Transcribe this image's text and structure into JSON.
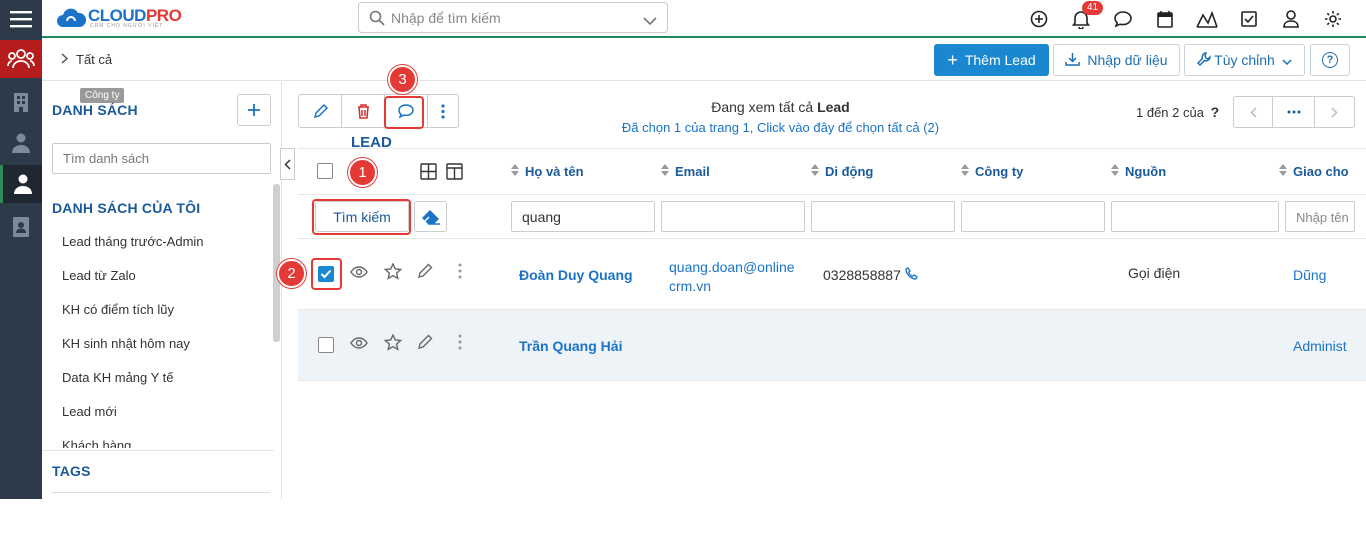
{
  "rail": {
    "items": [
      "menu-icon",
      "users-group-icon",
      "building-icon",
      "contacts-icon",
      "person-icon",
      "document-person-icon"
    ],
    "tooltip": "Công ty"
  },
  "topbar": {
    "logo_text_prefix": "CLOUD",
    "logo_text_suffix": "PRO",
    "logo_tagline": "CRM CHO NGƯỜI VIỆT",
    "search_placeholder": "Nhập để tìm kiếm",
    "notification_count": "41",
    "icons": [
      "plus-circle-icon",
      "bell-icon",
      "chat-icon",
      "calendar-icon",
      "chart-icon",
      "checkbox-icon",
      "user-icon",
      "gear-icon"
    ]
  },
  "breadcrumb": {
    "module": "LEAD",
    "view": "Tất cả"
  },
  "header_buttons": {
    "add": "Thêm Lead",
    "import": "Nhập dữ liệu",
    "customize": "Tùy chỉnh",
    "help": "?"
  },
  "sidebar": {
    "section_title": "DANH SÁCH",
    "filter_placeholder": "Tìm danh sách",
    "my_lists_title": "DANH SÁCH CỦA TÔI",
    "items": [
      "Lead tháng trước-Admin",
      "Lead từ Zalo",
      "KH có điểm tích lũy",
      "KH sinh nhật hôm nay",
      "Data KH mảng Y tế",
      "Lead mới",
      "Khách hàng"
    ],
    "tags_title": "TAGS"
  },
  "toolbar": {
    "viewing_prefix": "Đang xem tất cả",
    "viewing_module": "Lead",
    "selected_text": "Đã chọn 1 của trang 1, Click vào đây để chọn tất cả (2)",
    "pager_text": "1 đến 2 của",
    "pager_help": "?"
  },
  "table": {
    "columns": [
      "Họ và tên",
      "Email",
      "Di động",
      "Công ty",
      "Nguồn",
      "Giao cho"
    ],
    "search_button": "Tìm kiếm",
    "filters": {
      "name": "quang",
      "email": "",
      "mobile": "",
      "company": "",
      "source": "",
      "assigned_placeholder": "Nhập tên"
    },
    "rows": [
      {
        "checked": true,
        "name": "Đoàn Duy Quang",
        "email_line1": "quang.doan@online",
        "email_line2": "crm.vn",
        "mobile": "0328858887",
        "company": "",
        "source": "Gọi điện",
        "assigned": "Dũng"
      },
      {
        "checked": false,
        "name": "Trần Quang Hải",
        "email_line1": "",
        "email_line2": "",
        "mobile": "",
        "company": "",
        "source": "",
        "assigned": "Administ"
      }
    ]
  },
  "annotations": {
    "step1": "1",
    "step2": "2",
    "step3": "3"
  },
  "colors": {
    "accent": "#1a88d0",
    "rail": "#2d3a4a",
    "active_rail": "#b71c1c",
    "marker": "#e53935"
  }
}
